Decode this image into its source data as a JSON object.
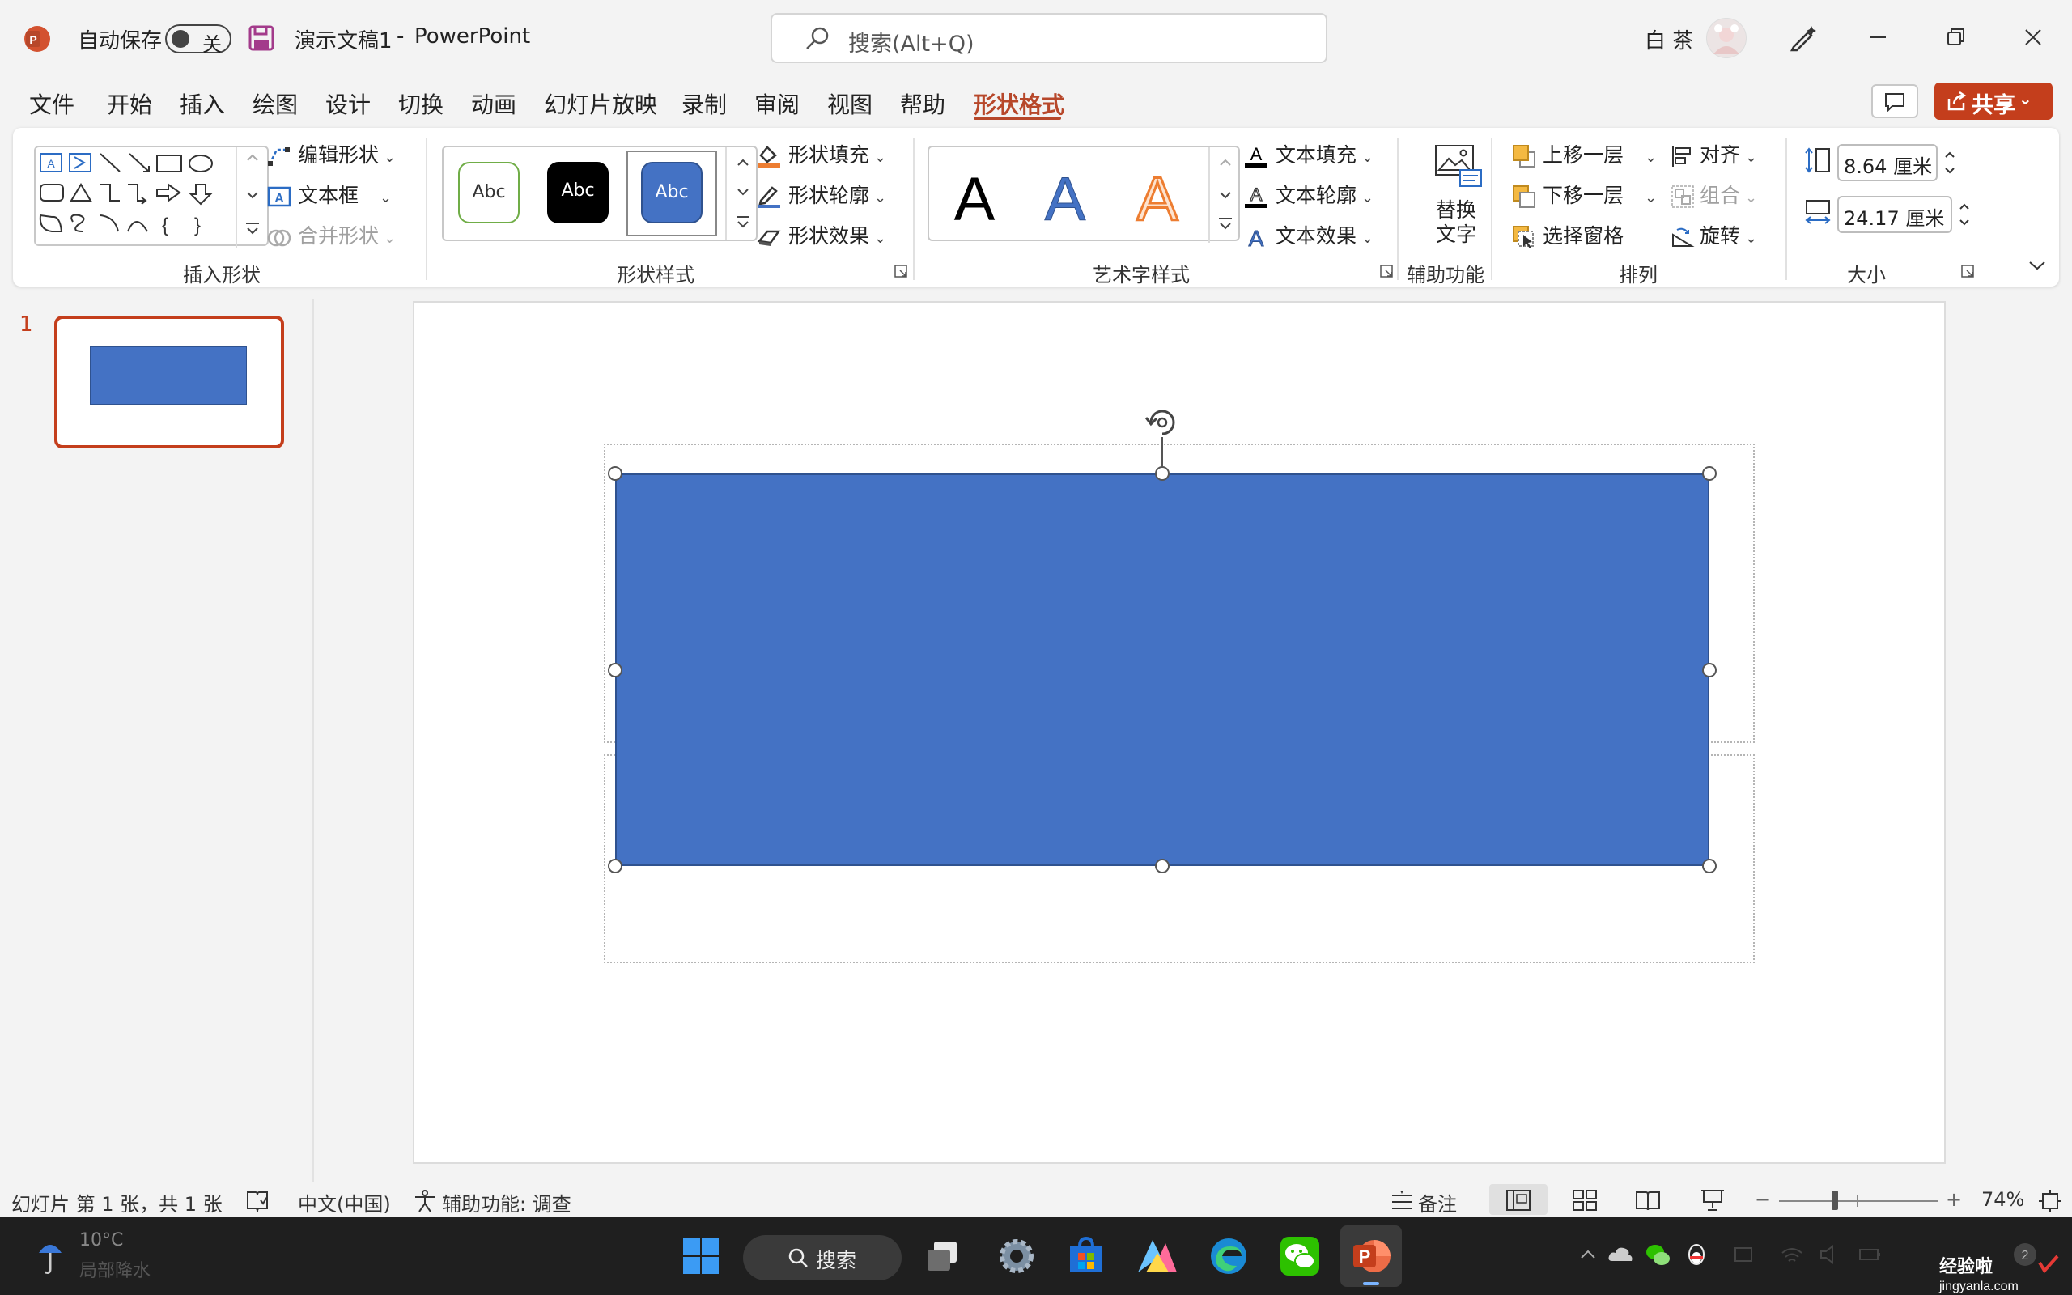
{
  "titlebar": {
    "autosave_label": "自动保存",
    "autosave_toggle_value": "关",
    "doc_title": "演示文稿1",
    "separator": "-",
    "app_name": "PowerPoint",
    "search_placeholder": "搜索(Alt+Q)",
    "user_name": "白 茶"
  },
  "menu": {
    "tabs": [
      "文件",
      "开始",
      "插入",
      "绘图",
      "设计",
      "切换",
      "动画",
      "幻灯片放映",
      "录制",
      "审阅",
      "视图",
      "帮助",
      "形状格式"
    ],
    "active_tab": "形状格式",
    "share_label": "共享"
  },
  "ribbon": {
    "insert_shapes": {
      "label": "插入形状",
      "edit_shape": "编辑形状",
      "text_box": "文本框",
      "merge_shapes": "合并形状"
    },
    "shape_styles": {
      "label": "形状样式",
      "swatches": [
        "Abc",
        "Abc",
        "Abc"
      ],
      "shape_fill": "形状填充",
      "shape_outline": "形状轮廓",
      "shape_effects": "形状效果"
    },
    "wordart_styles": {
      "label": "艺术字样式",
      "samples": [
        "A",
        "A",
        "A"
      ],
      "text_fill": "文本填充",
      "text_outline": "文本轮廓",
      "text_effects": "文本效果"
    },
    "accessibility": {
      "label": "辅助功能",
      "alt_text_line1": "替换",
      "alt_text_line2": "文字"
    },
    "arrange": {
      "label": "排列",
      "bring_forward": "上移一层",
      "send_backward": "下移一层",
      "selection_pane": "选择窗格",
      "align": "对齐",
      "group": "组合",
      "rotate": "旋转"
    },
    "size": {
      "label": "大小",
      "height": "8.64 厘米",
      "width": "24.17 厘米"
    }
  },
  "slides_pane": {
    "slide_number": "1"
  },
  "statusbar": {
    "slide_info": "幻灯片 第 1 张，共 1 张",
    "language": "中文(中国)",
    "accessibility": "辅助功能: 调查",
    "notes": "备注",
    "zoom_minus": "−",
    "zoom_plus": "+",
    "zoom": "74%"
  },
  "taskbar": {
    "search_label": "搜索",
    "weather_temp": "10°C",
    "weather_desc": "局部降水"
  },
  "watermark": {
    "text_cn": "经验啦",
    "text_url": "jingyanla.com"
  },
  "colors": {
    "accent": "#b7472a",
    "share": "#c43e1c",
    "shape_fill": "#4472c4",
    "shape_border": "#2f528f"
  }
}
